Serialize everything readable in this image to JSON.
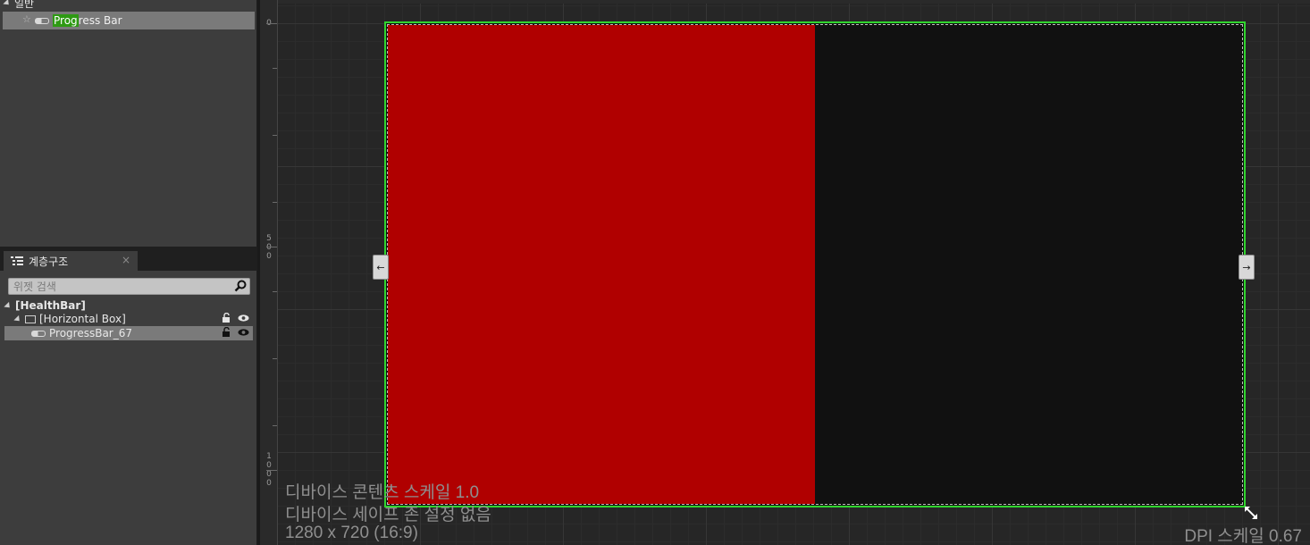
{
  "palette": {
    "category": "일반",
    "item_prefix": "Prog",
    "item_suffix": "ress Bar"
  },
  "hierarchy": {
    "tab_label": "계층구조",
    "search_placeholder": "위젯 검색",
    "items": [
      {
        "label": "[HealthBar]",
        "level": 0
      },
      {
        "label": "[Horizontal Box]",
        "level": 1
      },
      {
        "label": "ProgressBar_67",
        "level": 2,
        "selected": true
      }
    ]
  },
  "designer": {
    "ruler_labels": [
      "0",
      "5\n0\n0",
      "1\n0\n0\n0"
    ],
    "progress_percent": 50,
    "fill_color": "#b00000",
    "background_color": "#111111",
    "selection_color": "#30d52e",
    "content_scale": "디바이스 콘텐츠 스케일 1.0",
    "safe_zone": "디바이스 세이프 존 설정 없음",
    "resolution": "1280 x 720 (16:9)",
    "dpi_scale": "DPI 스케일 0.67"
  },
  "icons": [
    "star-icon",
    "progress-bar-icon",
    "hierarchy-list-icon",
    "close-icon",
    "search-icon",
    "horizontal-box-icon",
    "lock-icon",
    "eye-icon",
    "left-arrow-icon",
    "right-arrow-icon",
    "resize-icon"
  ]
}
